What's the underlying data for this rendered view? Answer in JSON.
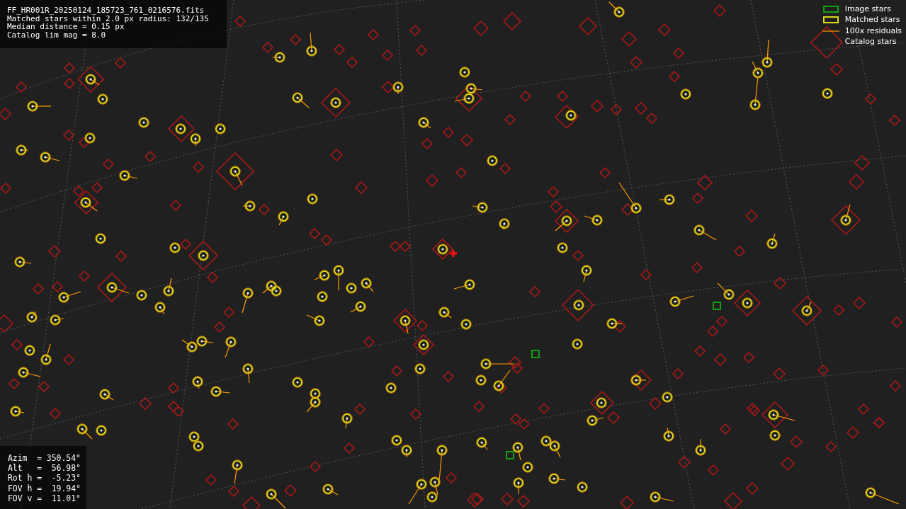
{
  "info_lines": [
    "FF_HR001R_20250124_185723_761_0216576.fits",
    "Matched stars within 2.0 px radius: 132/135",
    "Median distance = 0.15 px",
    "Catalog lim mag = 8.0"
  ],
  "legend": [
    {
      "kind": "image",
      "label": "Image stars"
    },
    {
      "kind": "matched",
      "label": "Matched stars"
    },
    {
      "kind": "residual",
      "label": "100x residuals"
    },
    {
      "kind": "catalog",
      "label": "Catalog stars"
    }
  ],
  "pointing_lines": [
    "Azim  = 350.54°",
    "Alt   =  56.98°",
    "Rot h =  -5.23°",
    "FOV h =  19.94°",
    "FOV v =  11.01°"
  ]
}
